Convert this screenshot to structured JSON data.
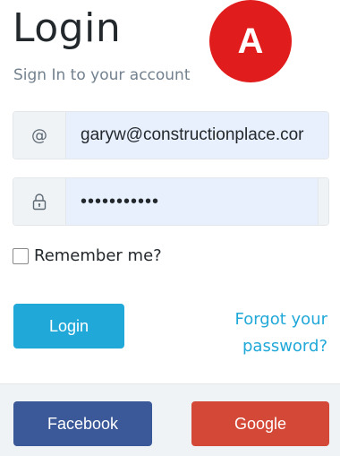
{
  "header": {
    "title": "Login",
    "badge_letter": "A",
    "subtitle": "Sign In to your account"
  },
  "form": {
    "email_addon": "@",
    "email_value": "garyw@constructionplace.cor",
    "password_mask": "•••••••••••",
    "remember_label": "Remember me?",
    "remember_checked": false
  },
  "actions": {
    "login_label": "Login",
    "forgot_line1": "Forgot your",
    "forgot_line2": "password?"
  },
  "social": {
    "facebook_label": "Facebook",
    "google_label": "Google"
  },
  "icons": {
    "email": "at-icon",
    "password": "lock-icon",
    "reveal": "eye-icon"
  },
  "colors": {
    "primary": "#20a8d8",
    "badge": "#e11c1c",
    "facebook": "#3b5998",
    "google": "#d34836",
    "autofill_bg": "#e8f0fe"
  }
}
